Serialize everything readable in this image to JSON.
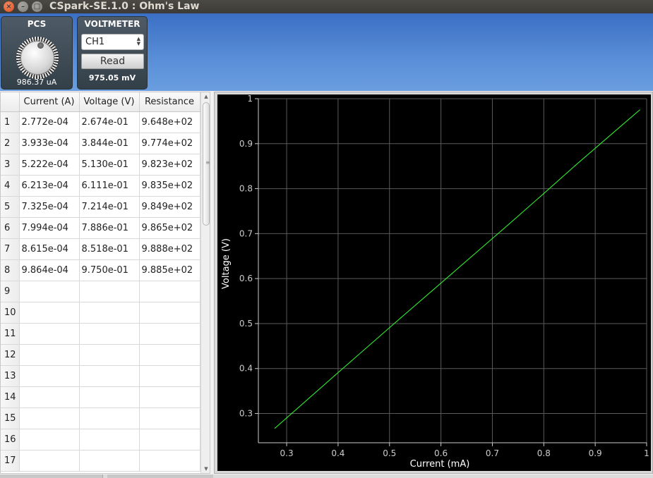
{
  "window": {
    "title": "CSpark-SE.1.0 : Ohm's Law",
    "close_symbol": "×",
    "min_symbol": "–",
    "max_symbol": "□"
  },
  "pcs": {
    "title": "PCS",
    "value": "986.37 uA"
  },
  "voltmeter": {
    "title": "VOLTMETER",
    "channel": "CH1",
    "read_label": "Read",
    "value": "975.05 mV"
  },
  "table": {
    "headers": [
      "Current (A)",
      "Voltage (V)",
      "Resistance"
    ],
    "rows": [
      {
        "num": "1",
        "current": "2.772e-04",
        "voltage": "2.674e-01",
        "resistance": "9.648e+02"
      },
      {
        "num": "2",
        "current": "3.933e-04",
        "voltage": "3.844e-01",
        "resistance": "9.774e+02"
      },
      {
        "num": "3",
        "current": "5.222e-04",
        "voltage": "5.130e-01",
        "resistance": "9.823e+02"
      },
      {
        "num": "4",
        "current": "6.213e-04",
        "voltage": "6.111e-01",
        "resistance": "9.835e+02"
      },
      {
        "num": "5",
        "current": "7.325e-04",
        "voltage": "7.214e-01",
        "resistance": "9.849e+02"
      },
      {
        "num": "6",
        "current": "7.994e-04",
        "voltage": "7.886e-01",
        "resistance": "9.865e+02"
      },
      {
        "num": "7",
        "current": "8.615e-04",
        "voltage": "8.518e-01",
        "resistance": "9.888e+02"
      },
      {
        "num": "8",
        "current": "9.864e-04",
        "voltage": "9.750e-01",
        "resistance": "9.885e+02"
      },
      {
        "num": "9",
        "current": "",
        "voltage": "",
        "resistance": ""
      },
      {
        "num": "10",
        "current": "",
        "voltage": "",
        "resistance": ""
      },
      {
        "num": "11",
        "current": "",
        "voltage": "",
        "resistance": ""
      },
      {
        "num": "12",
        "current": "",
        "voltage": "",
        "resistance": ""
      },
      {
        "num": "13",
        "current": "",
        "voltage": "",
        "resistance": ""
      },
      {
        "num": "14",
        "current": "",
        "voltage": "",
        "resistance": ""
      },
      {
        "num": "15",
        "current": "",
        "voltage": "",
        "resistance": ""
      },
      {
        "num": "16",
        "current": "",
        "voltage": "",
        "resistance": ""
      },
      {
        "num": "17",
        "current": "",
        "voltage": "",
        "resistance": ""
      }
    ]
  },
  "chart_data": {
    "type": "line",
    "xlabel": "Current (mA)",
    "ylabel": "Voltage (V)",
    "xlim": [
      0.245,
      1.0
    ],
    "ylim": [
      0.235,
      1.0
    ],
    "xticks": [
      "0.3",
      "0.4",
      "0.5",
      "0.6",
      "0.7",
      "0.8",
      "0.9",
      "1"
    ],
    "yticks": [
      "0.3",
      "0.4",
      "0.5",
      "0.6",
      "0.7",
      "0.8",
      "0.9",
      "1"
    ],
    "grid": true,
    "series": [
      {
        "color": "#33ff33",
        "x": [
          0.2772,
          0.3933,
          0.5222,
          0.6213,
          0.7325,
          0.7994,
          0.8615,
          0.9864
        ],
        "y": [
          0.2674,
          0.3844,
          0.513,
          0.6111,
          0.7214,
          0.7886,
          0.8518,
          0.975
        ]
      }
    ],
    "colors": {
      "background": "#000000",
      "grid": "#5a5a5a",
      "axis": "#cccccc",
      "line": "#33ff33"
    }
  }
}
